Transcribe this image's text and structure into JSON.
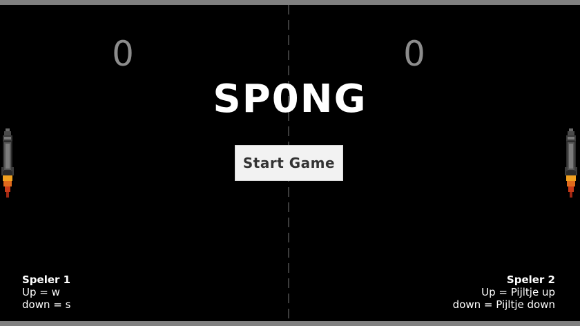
{
  "title": "SP0NG",
  "scores": {
    "player1": "0",
    "player2": "0"
  },
  "start_button": {
    "label": "Start Game"
  },
  "player1": {
    "name": "Speler 1",
    "up": "Up = w",
    "down": "down = s"
  },
  "player2": {
    "name": "Speler 2",
    "up": "Up = Pijltje up",
    "down": "down = Pijltje down"
  },
  "colors": {
    "background": "#000000",
    "walls": "#808080",
    "score": "#8c8c8c",
    "title": "#ffffff",
    "button_bg": "#f2f2f2",
    "button_text": "#333333",
    "flame": "#d9481a"
  },
  "icons": {
    "paddle": "rocket-paddle-icon"
  }
}
